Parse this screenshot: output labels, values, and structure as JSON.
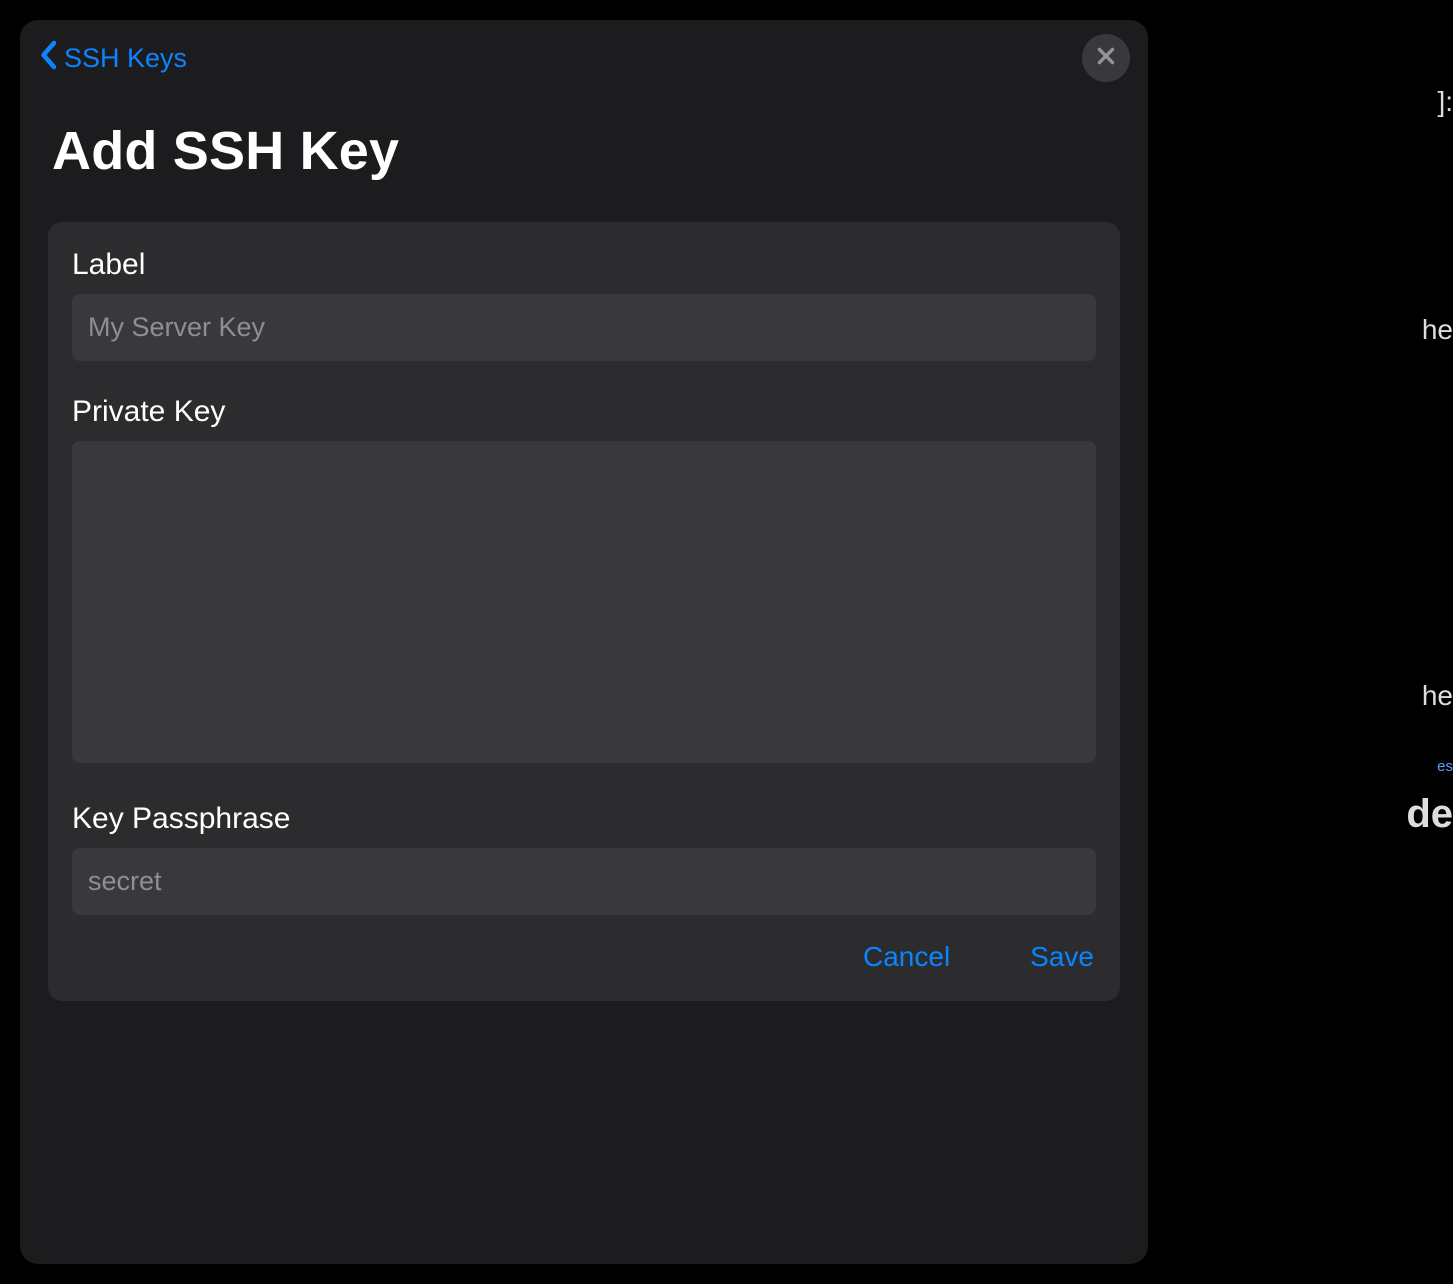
{
  "nav": {
    "back_label": "SSH Keys"
  },
  "modal": {
    "title": "Add SSH Key"
  },
  "form": {
    "label_field": {
      "label": "Label",
      "placeholder": "My Server Key",
      "value": ""
    },
    "private_key_field": {
      "label": "Private Key",
      "placeholder": "",
      "value": ""
    },
    "passphrase_field": {
      "label": "Key Passphrase",
      "placeholder": "secret",
      "value": ""
    }
  },
  "buttons": {
    "cancel": "Cancel",
    "save": "Save"
  },
  "bg": {
    "frag1": "]:",
    "frag2": "he",
    "frag3": "he",
    "frag4": "es",
    "frag5": "de"
  },
  "colors": {
    "accent": "#0a84ff",
    "modal_bg": "#1c1c1e",
    "card_bg": "#2c2c2e",
    "input_bg": "#39393d",
    "placeholder": "#8e8e93"
  }
}
